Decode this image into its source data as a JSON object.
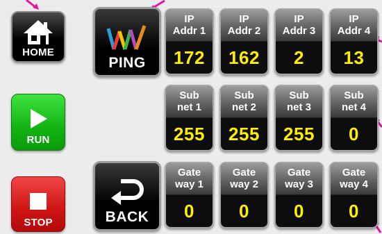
{
  "left_buttons": {
    "home_label": "HOME",
    "run_label": "RUN",
    "stop_label": "STOP"
  },
  "action_buttons": {
    "ping_label": "PING",
    "back_label": "BACK"
  },
  "ip_fields": [
    {
      "line1": "IP",
      "line2": "Addr 1",
      "value": "172"
    },
    {
      "line1": "IP",
      "line2": "Addr 2",
      "value": "162"
    },
    {
      "line1": "IP",
      "line2": "Addr 3",
      "value": "2"
    },
    {
      "line1": "IP",
      "line2": "Addr 4",
      "value": "13"
    }
  ],
  "subnet_fields": [
    {
      "line1": "Sub",
      "line2": "net 1",
      "value": "255"
    },
    {
      "line1": "Sub",
      "line2": "net 2",
      "value": "255"
    },
    {
      "line1": "Sub",
      "line2": "net 3",
      "value": "255"
    },
    {
      "line1": "Sub",
      "line2": "net 4",
      "value": "0"
    }
  ],
  "gateway_fields": [
    {
      "line1": "Gate",
      "line2": "way 1",
      "value": "0"
    },
    {
      "line1": "Gate",
      "line2": "way 2",
      "value": "0"
    },
    {
      "line1": "Gate",
      "line2": "way 3",
      "value": "0"
    },
    {
      "line1": "Gate",
      "line2": "way 4",
      "value": "0"
    }
  ],
  "icons": {
    "home": "house-icon",
    "run": "play-icon",
    "stop": "stop-icon",
    "ping": "ping-logo-icon",
    "back": "return-arrow-icon"
  },
  "colors": {
    "value_text": "#ffee00",
    "run_green": "#13b313",
    "stop_red": "#cf1414",
    "annotation_pointer": "#e5139c"
  }
}
